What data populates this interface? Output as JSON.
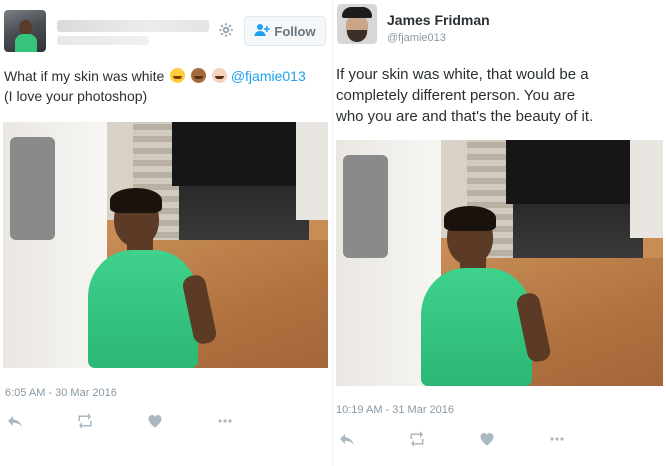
{
  "left_tweet": {
    "follow_label": "Follow",
    "text_line1": "What if my skin was white",
    "mention": "@fjamie013",
    "text_line2": "(I love your photoshop)",
    "emojis": [
      "laughing-face-emoji",
      "dark-skin-face-emoji",
      "light-skin-face-emoji"
    ],
    "timestamp": "6:05 AM - 30 Mar 2016"
  },
  "right_tweet": {
    "name": "James Fridman",
    "handle": "@fjamie013",
    "text_lines": [
      "If your skin was white, that would be a",
      "completely different person. You are",
      "who you are and that's the beauty of it."
    ],
    "timestamp": "10:19 AM - 31 Mar 2016"
  },
  "icons": {
    "settings": "gear-icon",
    "follow": "add-user-icon",
    "reply": "reply-icon",
    "retweet": "retweet-icon",
    "like": "heart-icon",
    "more": "more-icon"
  },
  "colors": {
    "link": "#1da1f2",
    "meta": "#8899a6",
    "action": "#aab8c2"
  }
}
